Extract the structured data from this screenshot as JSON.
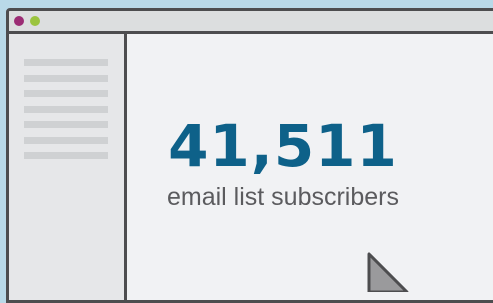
{
  "window": {
    "controls": [
      {
        "name": "close",
        "color": "#9b2c74"
      },
      {
        "name": "minimize",
        "color": "#9bc43f"
      }
    ]
  },
  "sidebar": {
    "placeholder_line_count": 7
  },
  "main": {
    "metric": {
      "value": "41,511",
      "label": "email list subscribers"
    }
  },
  "cursor": {
    "icon": "pointer-arrow-icon"
  },
  "colors": {
    "background": "#b9d9e8",
    "accent": "#0e6189",
    "border": "#4d4d4f",
    "text": "#5b5b5e"
  }
}
